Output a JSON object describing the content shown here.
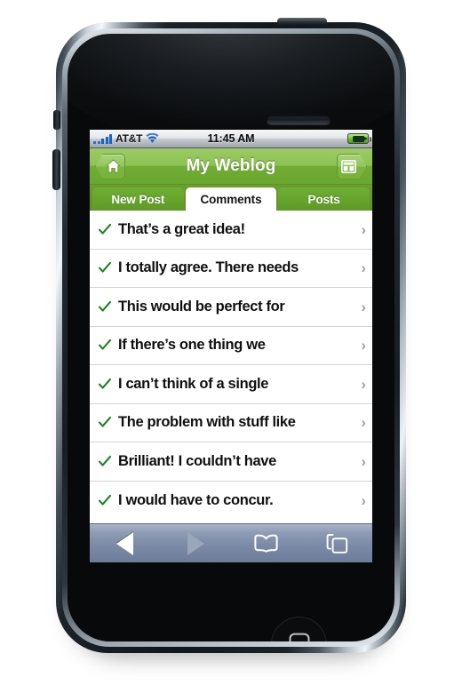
{
  "device": {
    "name": "iphone",
    "earpiece": "earpiece-speaker",
    "home_button": "home-button"
  },
  "status_bar": {
    "signal_icon": "signal-bars-icon",
    "carrier": "AT&T",
    "wifi_icon": "wifi-icon",
    "time": "11:45 AM",
    "battery_icon": "battery-charging-icon"
  },
  "nav_bar": {
    "back_icon": "home-icon",
    "title": "My Weblog",
    "forward_icon": "layout-icon"
  },
  "tabs": [
    {
      "label": "New Post",
      "active": false
    },
    {
      "label": "Comments",
      "active": true
    },
    {
      "label": "Posts",
      "active": false
    }
  ],
  "list": {
    "check_icon": "checkmark-icon",
    "chevron": "›",
    "items": [
      {
        "text": "That’s a great idea!"
      },
      {
        "text": "I totally agree. There needs"
      },
      {
        "text": "This would be perfect for"
      },
      {
        "text": "If there’s one thing we"
      },
      {
        "text": "I can’t think of a single"
      },
      {
        "text": "The problem with stuff like"
      },
      {
        "text": "Brilliant! I couldn’t have"
      },
      {
        "text": "I would have to concur."
      }
    ]
  },
  "toolbar": {
    "back_icon": "back-arrow-icon",
    "forward_icon": "forward-arrow-icon",
    "bookmarks_icon": "book-icon",
    "pages_icon": "pages-icon"
  },
  "colors": {
    "brand_green": "#8dc254",
    "tab_strip_green": "#658f29",
    "check_green": "#19871f",
    "toolbar_blue": "#7b8aa6",
    "signal_blue": "#1a62c4",
    "battery_green": "#74c62d"
  }
}
